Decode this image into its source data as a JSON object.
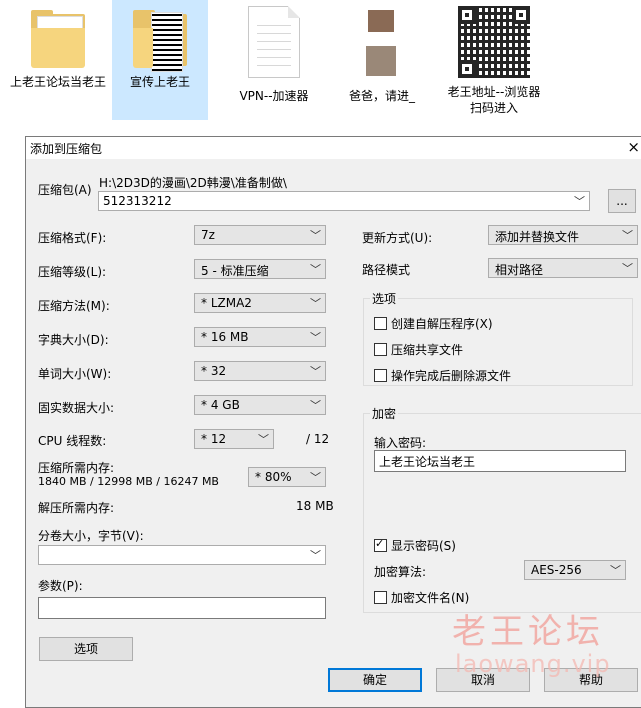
{
  "desktop": {
    "items": [
      {
        "label": "上老王论坛当老王",
        "type": "folder"
      },
      {
        "label": "宣传上老王",
        "type": "folder-qr",
        "selected": true
      },
      {
        "label": "VPN--加速器",
        "type": "document"
      },
      {
        "label": "爸爸，请进_",
        "type": "photos"
      },
      {
        "label": "老王地址--浏览器扫码进入",
        "type": "qr-image"
      }
    ]
  },
  "dialog": {
    "title": "添加到压缩包",
    "close_glyph": "×",
    "archive": {
      "label": "压缩包(A)",
      "path": "H:\\2D3D的漫画\\2D韩漫\\准备制做\\",
      "name": "512313212",
      "browse_label": "..."
    },
    "left": {
      "format": {
        "label": "压缩格式(F):",
        "value": "7z"
      },
      "level": {
        "label": "压缩等级(L):",
        "value": "5 - 标准压缩"
      },
      "method": {
        "label": "压缩方法(M):",
        "value": "* LZMA2"
      },
      "dict": {
        "label": "字典大小(D):",
        "value": "* 16 MB"
      },
      "word": {
        "label": "单词大小(W):",
        "value": "* 32"
      },
      "solid": {
        "label": "固实数据大小:",
        "value": "* 4 GB"
      },
      "cpu": {
        "label": "CPU 线程数:",
        "value": "* 12",
        "max": "/ 12"
      },
      "mem_comp": {
        "label": "压缩所需内存:",
        "detail": "1840 MB / 12998 MB / 16247 MB",
        "value": "* 80%"
      },
      "mem_decomp": {
        "label": "解压所需内存:",
        "value": "18 MB"
      },
      "split": {
        "label": "分卷大小，字节(V):",
        "value": ""
      },
      "params": {
        "label": "参数(P):",
        "value": ""
      },
      "options_button": "选项"
    },
    "right": {
      "update": {
        "label": "更新方式(U):",
        "value": "添加并替换文件"
      },
      "pathmode": {
        "label": "路径模式",
        "value": "相对路径"
      },
      "options_group": {
        "title": "选项",
        "sfx": {
          "label": "创建自解压程序(X)",
          "checked": false
        },
        "shared": {
          "label": "压缩共享文件",
          "checked": false
        },
        "delete": {
          "label": "操作完成后删除源文件",
          "checked": false
        }
      },
      "encryption": {
        "title": "加密",
        "password_label": "输入密码:",
        "password_value": "上老王论坛当老王",
        "show_password": {
          "label": "显示密码(S)",
          "checked": true
        },
        "method_label": "加密算法:",
        "method_value": "AES-256",
        "encrypt_names": {
          "label": "加密文件名(N)",
          "checked": false
        }
      }
    },
    "buttons": {
      "ok": "确定",
      "cancel": "取消",
      "help": "帮助"
    }
  },
  "watermark": {
    "cn": "老王论坛",
    "url": "laowang.vip"
  },
  "colors": {
    "selection": "#cce8ff",
    "focus": "#0078d7",
    "watermark": "#f2a8a2"
  }
}
